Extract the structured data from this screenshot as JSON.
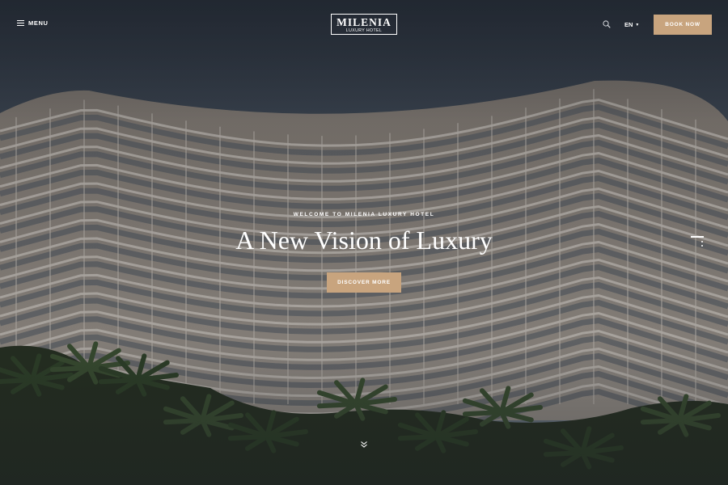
{
  "header": {
    "menu_label": "MENU",
    "logo": {
      "name": "MILENIA",
      "tagline": "LUXURY HOTEL"
    },
    "language": "EN",
    "book_label": "BOOK NOW",
    "icons": {
      "menu": "hamburger-icon",
      "search": "search-icon",
      "language_caret": "caret-down-icon"
    }
  },
  "hero": {
    "subtitle": "WELCOME TO MILENIA LUXURY HOTEL",
    "title": "A New Vision of Luxury",
    "cta_label": "DISCOVER MORE",
    "scroll_icon": "chevrons-down-icon",
    "slide_indicator_icon": "slide-indicator-icon"
  },
  "colors": {
    "accent": "#c8a47e",
    "text": "#ffffff",
    "sky_top": "#2b3441",
    "sky_bottom": "#7f8b96"
  }
}
